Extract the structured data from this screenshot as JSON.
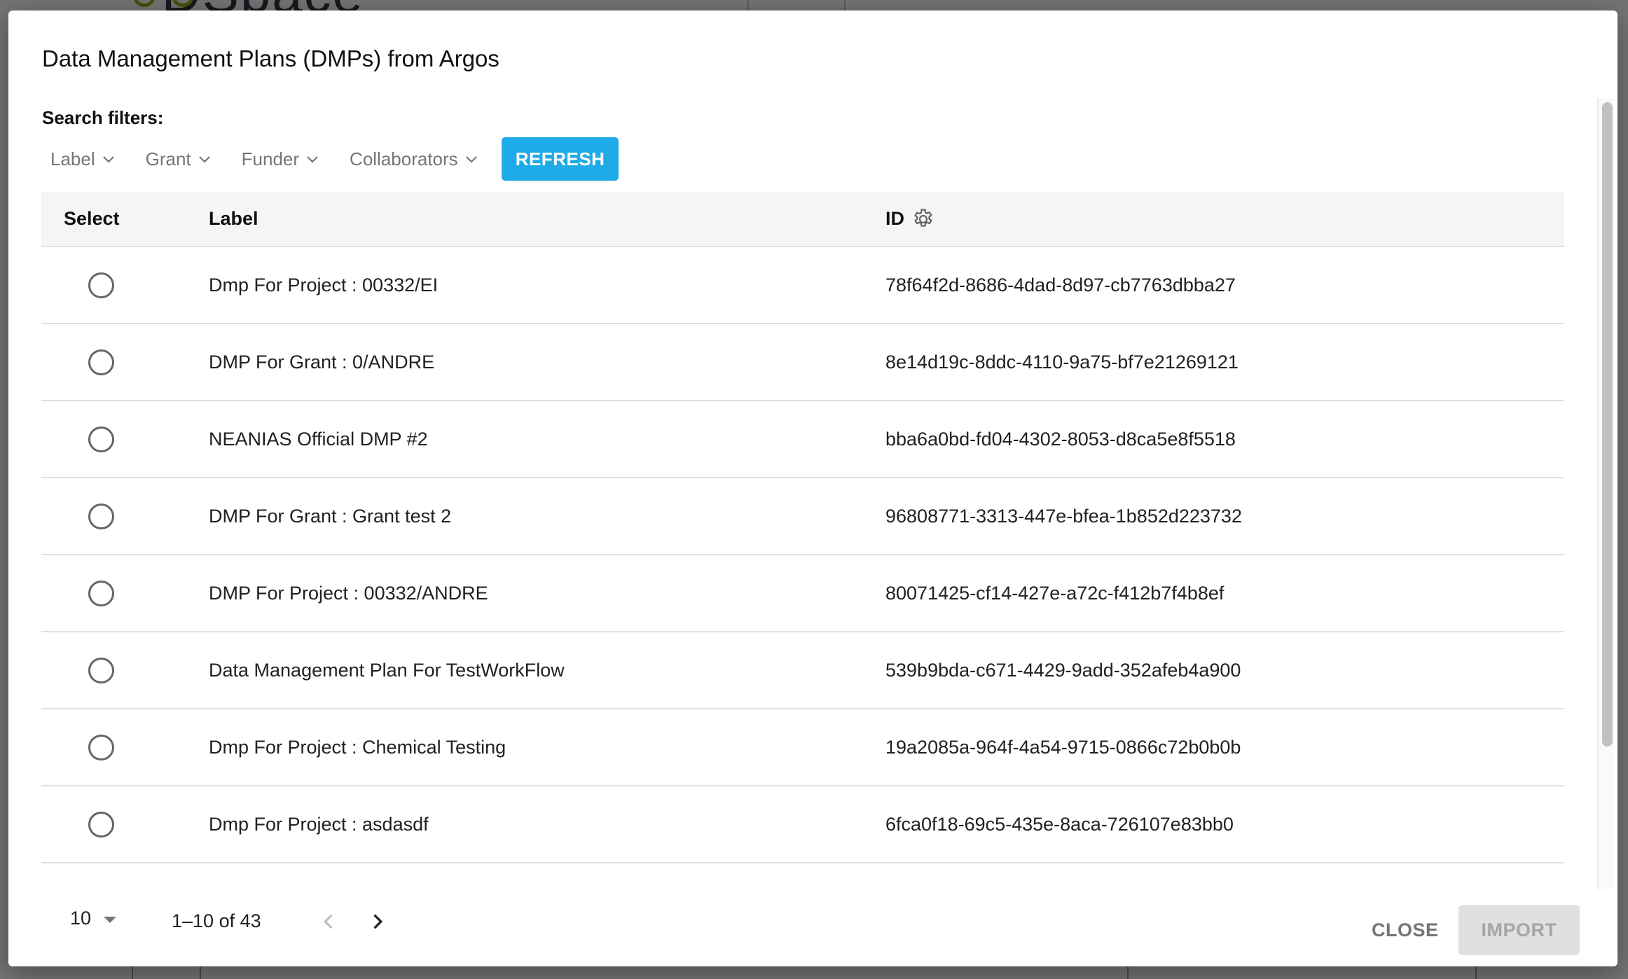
{
  "background": {
    "logo_text": "DSpace"
  },
  "dialog": {
    "title": "Data Management Plans (DMPs) from Argos",
    "filters_label": "Search filters:",
    "filters": [
      {
        "label": "Label",
        "icon": "chevron-down-icon"
      },
      {
        "label": "Grant",
        "icon": "chevron-down-icon"
      },
      {
        "label": "Funder",
        "icon": "chevron-down-icon"
      },
      {
        "label": "Collaborators",
        "icon": "chevron-down-icon"
      }
    ],
    "refresh_label": "REFRESH",
    "colors": {
      "accent": "#1fabe8",
      "header_bg": "#f5f5f5",
      "disabled_bg": "#e0e0e0"
    }
  },
  "table": {
    "columns": {
      "select": "Select",
      "label": "Label",
      "id": "ID",
      "id_icon": "gear-icon"
    },
    "rows": [
      {
        "label": "Dmp For Project : 00332/EI",
        "id": "78f64f2d-8686-4dad-8d97-cb7763dbba27",
        "selected": false
      },
      {
        "label": "DMP For Grant : 0/ANDRE",
        "id": "8e14d19c-8ddc-4110-9a75-bf7e21269121",
        "selected": false
      },
      {
        "label": "NEANIAS Official DMP #2",
        "id": "bba6a0bd-fd04-4302-8053-d8ca5e8f5518",
        "selected": false
      },
      {
        "label": "DMP For Grant : Grant test 2",
        "id": "96808771-3313-447e-bfea-1b852d223732",
        "selected": false
      },
      {
        "label": "DMP For Project : 00332/ANDRE",
        "id": "80071425-cf14-427e-a72c-f412b7f4b8ef",
        "selected": false
      },
      {
        "label": "Data Management Plan For TestWorkFlow",
        "id": "539b9bda-c671-4429-9add-352afeb4a900",
        "selected": false
      },
      {
        "label": "Dmp For Project : Chemical Testing",
        "id": "19a2085a-964f-4a54-9715-0866c72b0b0b",
        "selected": false
      },
      {
        "label": "Dmp For Project : asdasdf",
        "id": "6fca0f18-69c5-435e-8aca-726107e83bb0",
        "selected": false
      }
    ]
  },
  "paginator": {
    "page_size": "10",
    "range_label": "1–10 of 43",
    "prev_enabled": false,
    "next_enabled": true
  },
  "actions": {
    "close_label": "CLOSE",
    "import_label": "IMPORT",
    "import_enabled": false
  }
}
